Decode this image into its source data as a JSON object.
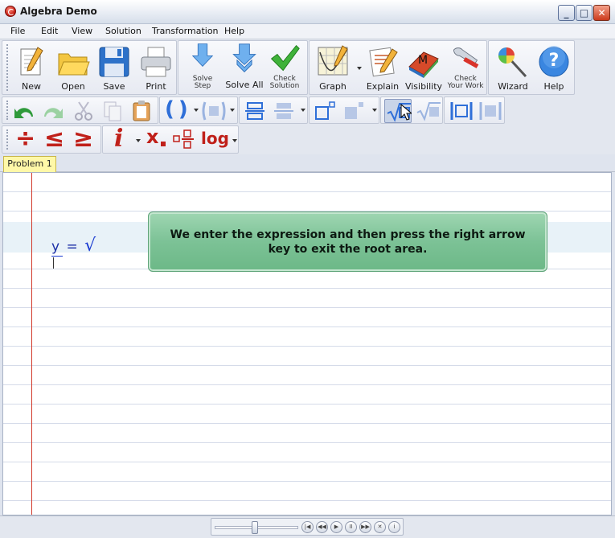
{
  "window": {
    "title": "Algebra Demo",
    "controls": {
      "minimize": "_",
      "maximize": "□",
      "close": "✕"
    }
  },
  "menu": [
    "File",
    "Edit",
    "View",
    "Solution",
    "Transformation",
    "Help"
  ],
  "toolbar_main": {
    "file": [
      {
        "label": "New",
        "icon": "new-document-icon"
      },
      {
        "label": "Open",
        "icon": "folder-open-icon"
      },
      {
        "label": "Save",
        "icon": "floppy-disk-icon"
      },
      {
        "label": "Print",
        "icon": "printer-icon"
      }
    ],
    "solve": {
      "solve_step_l1": "Solve",
      "solve_step_l2": "Step",
      "solve_all": "Solve All",
      "check_solution_l1": "Check",
      "check_solution_l2": "Solution"
    },
    "tools": {
      "graph": "Graph",
      "explain": "Explain",
      "visibility": "Visibility",
      "visibility_badge": "M",
      "check_work_l1": "Check",
      "check_work_l2": "Your Work"
    },
    "help": {
      "wizard": "Wizard",
      "help": "Help",
      "help_glyph": "?"
    }
  },
  "toolbar_edit": {
    "items": [
      "undo-icon",
      "redo-icon",
      "cut-icon",
      "copy-icon",
      "paste-icon",
      "parentheses-icon",
      "brackets-icon",
      "fraction-icon",
      "fraction-alt-icon",
      "superscript-icon",
      "superscript-alt-icon",
      "square-root-icon",
      "nth-root-icon",
      "absolute-value-icon",
      "absolute-value-alt-icon"
    ],
    "paren_glyph": "( )"
  },
  "toolbar_math": {
    "divide": "÷",
    "le": "≤",
    "ge": "≥",
    "info": "i",
    "subscript": "x",
    "log": "log"
  },
  "tabs": [
    {
      "label": "Problem 1",
      "active": true
    }
  ],
  "worksheet": {
    "equation_lhs": "y",
    "equation_eq": "=",
    "equation_radical": "√"
  },
  "callout": {
    "text": "We enter the expression and then press the right arrow key to exit the root area."
  },
  "player": {
    "position_fraction": 0.48,
    "controls": [
      "first-icon",
      "rewind-icon",
      "play-icon",
      "pause-icon",
      "fast-forward-icon",
      "stop-icon",
      "info-icon"
    ]
  },
  "colors": {
    "margin_line": "#d23a2c",
    "callout_bg": "#7cc296",
    "tab_bg": "#fff8a8",
    "math_red": "#c0201a",
    "blue_icon": "#2f6fd8"
  }
}
